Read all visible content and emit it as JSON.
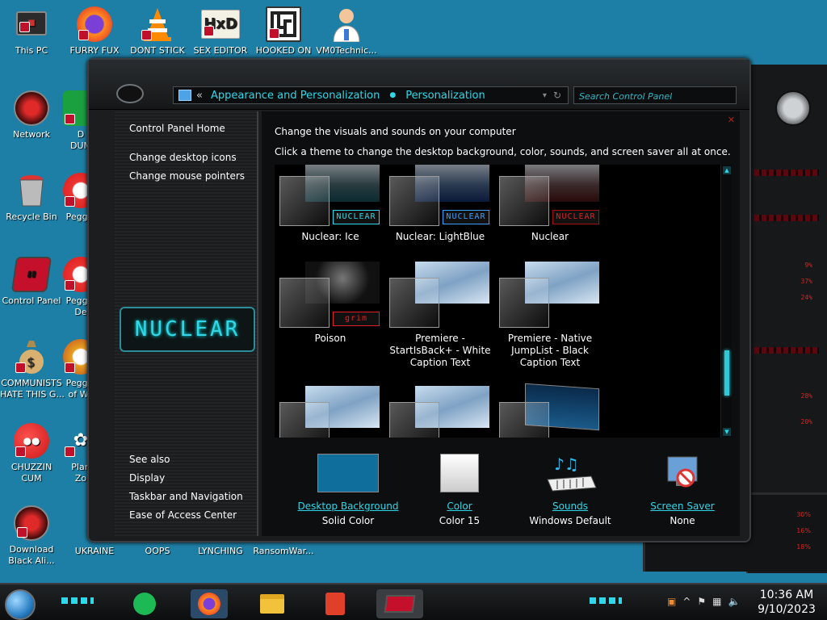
{
  "desktop": {
    "icons": [
      {
        "label": "This PC"
      },
      {
        "label": "FURRY FUX"
      },
      {
        "label": "DONT STICK"
      },
      {
        "label": "SEX EDITOR"
      },
      {
        "label": "HOOKED ON"
      },
      {
        "label": "VM0Technic..."
      },
      {
        "label": "Network"
      },
      {
        "label": "D\nDUM"
      },
      {
        "label": "Recycle Bin"
      },
      {
        "label": "Peggle"
      },
      {
        "label": "Control Panel"
      },
      {
        "label": "Peggle\nDe"
      },
      {
        "label": "COMMUNISTS\nHATE THIS G..."
      },
      {
        "label": "Peggle\nof Wa"
      },
      {
        "label": "CHUZZIN\nCUM"
      },
      {
        "label": "Plan\nZo"
      },
      {
        "label": "Download\nBlack Ali..."
      },
      {
        "label": "UKRAINE"
      },
      {
        "label": "OOPS"
      },
      {
        "label": "LYNCHING"
      },
      {
        "label": "RansomWar..."
      }
    ],
    "right_panel_percents": [
      "9%",
      "37%",
      "24%",
      "28%",
      "20%",
      "30%",
      "16%",
      "18%"
    ]
  },
  "window": {
    "address": {
      "nav": "«",
      "crumb1": "Appearance and Personalization",
      "crumb2": "Personalization",
      "refresh": "↻"
    },
    "search": {
      "placeholder": "Search Control Panel"
    },
    "sidebar": {
      "home": "Control Panel Home",
      "links": [
        "Change desktop icons",
        "Change mouse pointers"
      ],
      "logo_text": "NUCLEAR",
      "see_also": "See also",
      "see_also_links": [
        "Display",
        "Taskbar and Navigation",
        "Ease of Access Center"
      ]
    },
    "content": {
      "heading": "Change the visuals and sounds on your computer",
      "subheading": "Click a theme to change the desktop background, color, sounds, and screen saver all at once.",
      "themes": [
        {
          "label": "Nuclear: Ice",
          "tag": "NUCLEAR",
          "tag_color": "#2fd8e8"
        },
        {
          "label": "Nuclear: LightBlue",
          "tag": "NUCLEAR",
          "tag_color": "#3aa0ff"
        },
        {
          "label": "Nuclear",
          "tag": "NUCLEAR",
          "tag_color": "#e02020"
        },
        {
          "label": "Poison",
          "tag": "grim",
          "tag_color": "#e02020"
        },
        {
          "label": "Premiere - StartIsBack+ - White Caption Text",
          "tag": "",
          "tag_color": ""
        },
        {
          "label": "Premiere - Native JumpList - Black Caption Text",
          "tag": "",
          "tag_color": ""
        }
      ],
      "settings": [
        {
          "link": "Desktop Background",
          "value": "Solid Color"
        },
        {
          "link": "Color",
          "value": "Color 15"
        },
        {
          "link": "Sounds",
          "value": "Windows Default"
        },
        {
          "link": "Screen Saver",
          "value": "None"
        }
      ]
    }
  },
  "taskbar": {
    "clock_time": "10:36 AM",
    "clock_date": "9/10/2023"
  },
  "colors": {
    "desktop": "#1e7fa6",
    "accent_cyan": "#2fd8e8",
    "desktop_bg_swatch": "#0f6e9c"
  }
}
